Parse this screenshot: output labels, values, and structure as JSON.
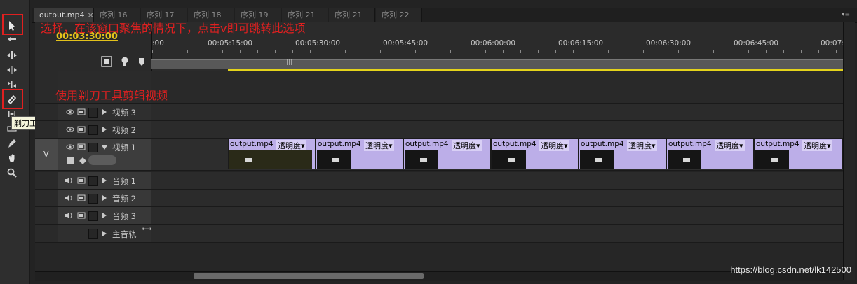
{
  "tools": {
    "tooltip": "剃刀工具 (C)",
    "items": [
      "selection-tool",
      "track-select-tool",
      "ripple-edit-tool",
      "rolling-edit-tool",
      "rate-stretch-tool",
      "razor-tool",
      "slip-tool",
      "slide-tool",
      "pen-tool",
      "hand-tool",
      "zoom-tool"
    ]
  },
  "tabs": [
    {
      "label": "output.mp4",
      "close": "×",
      "active": true
    },
    {
      "label": "序列 16"
    },
    {
      "label": "序列 17"
    },
    {
      "label": "序列 18"
    },
    {
      "label": "序列 19"
    },
    {
      "label": "序列 21"
    },
    {
      "label": "序列 21"
    },
    {
      "label": "序列 22"
    }
  ],
  "header": {
    "timecode": "00:03:30:00",
    "ruler_labels": [
      ":00",
      "00:05:15:00",
      "00:05:30:00",
      "00:05:45:00",
      "00:06:00:00",
      "00:06:15:00",
      "00:06:30:00",
      "00:06:45:00",
      "00:07:"
    ]
  },
  "tracks": {
    "video": [
      {
        "name": "视频 3",
        "expanded": false
      },
      {
        "name": "视频 2",
        "expanded": false
      },
      {
        "name": "视频 1",
        "expanded": true,
        "target": "V"
      }
    ],
    "audio": [
      {
        "name": "音频 1"
      },
      {
        "name": "音频 2"
      },
      {
        "name": "音频 3"
      },
      {
        "name": "主音轨"
      }
    ]
  },
  "clips": [
    {
      "label": "output.mp4",
      "opacity": "透明度"
    },
    {
      "label": "output.mp4",
      "opacity": "透明度"
    },
    {
      "label": "output.mp4",
      "opacity": "透明度"
    },
    {
      "label": "output.mp4",
      "opacity": "透明度"
    },
    {
      "label": "output.mp4",
      "opacity": "透明度"
    },
    {
      "label": "output.mp4",
      "opacity": "透明度"
    },
    {
      "label": "output.mp4",
      "opacity": "透明度"
    }
  ],
  "annotations": {
    "top": "选择，在该窗口聚焦的情况下，点击v即可跳转此选项",
    "razor": "使用剃刀工具剪辑视频"
  },
  "watermark": "https://blog.csdn.net/lk142500",
  "colors": {
    "timecode": "#e3c21b",
    "clip": "#bcaee8",
    "annotation": "#e02020",
    "work_area": "#e4d31b"
  }
}
